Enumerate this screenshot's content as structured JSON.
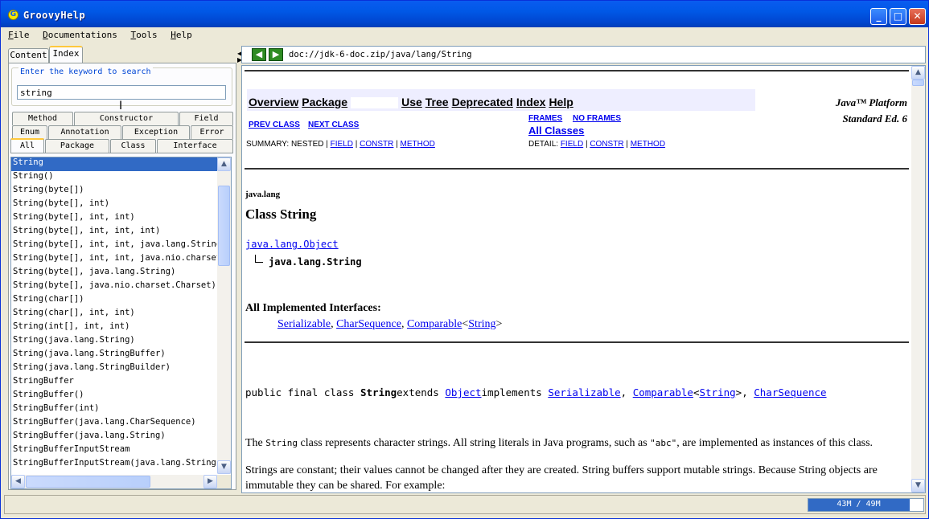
{
  "window": {
    "title": "GroovyHelp",
    "icon_glyph": "G",
    "minimize": "_",
    "maximize": "□",
    "close": "✕"
  },
  "menu": [
    "File",
    "Documentations",
    "Tools",
    "Help"
  ],
  "left": {
    "tabs": [
      "Content",
      "Index"
    ],
    "active_tab": "Index",
    "search_label": "Enter the keyword to search",
    "search_value": "string",
    "filter_tabs_row1": [
      "Method",
      "Constructor",
      "Field"
    ],
    "filter_tabs_row2": [
      "Enum",
      "Annotation",
      "Exception",
      "Error"
    ],
    "filter_tabs_row3": [
      "All",
      "Package",
      "Class",
      "Interface"
    ],
    "active_filter": "All",
    "results": [
      "String",
      "String()",
      "String(byte[])",
      "String(byte[], int)",
      "String(byte[], int, int)",
      "String(byte[], int, int, int)",
      "String(byte[], int, int, java.lang.String)",
      "String(byte[], int, int, java.nio.charset.Charset)",
      "String(byte[], java.lang.String)",
      "String(byte[], java.nio.charset.Charset)",
      "String(char[])",
      "String(char[], int, int)",
      "String(int[], int, int)",
      "String(java.lang.String)",
      "String(java.lang.StringBuffer)",
      "String(java.lang.StringBuilder)",
      "StringBuffer",
      "StringBuffer()",
      "StringBuffer(int)",
      "StringBuffer(java.lang.CharSequence)",
      "StringBuffer(java.lang.String)",
      "StringBufferInputStream",
      "StringBufferInputStream(java.lang.String)"
    ],
    "selected_index": 0
  },
  "right": {
    "back_icon": "back-arrow-icon",
    "forward_icon": "forward-arrow-icon",
    "address": "doc://jdk-6-doc.zip/java/lang/String",
    "doc": {
      "nav": [
        "Overview",
        "Package",
        "Use",
        "Tree",
        "Deprecated",
        "Index",
        "Help"
      ],
      "platform_line1": "Java™ Platform",
      "platform_line2": "Standard Ed. 6",
      "prev_class": "PREV CLASS",
      "next_class": "NEXT CLASS",
      "frames": "FRAMES",
      "no_frames": "NO FRAMES",
      "all_classes": "All Classes",
      "summary_prefix": "SUMMARY: NESTED | ",
      "detail_prefix": "DETAIL: ",
      "field": "FIELD",
      "constr": "CONSTR",
      "method": "METHOD",
      "sep": " | ",
      "package": "java.lang",
      "class_title": "Class String",
      "super_link": "java.lang.Object",
      "class_name": "java.lang.String",
      "impl_heading": "All Implemented Interfaces:",
      "impl_serializable": "Serializable",
      "impl_charseq": "CharSequence",
      "impl_comparable": "Comparable",
      "impl_string": "String",
      "comma": ", ",
      "lt": "<",
      "gt": ">",
      "decl_prefix": "public final class ",
      "decl_name": "String",
      "decl_extends": "extends ",
      "decl_object": "Object",
      "decl_implements": "implements ",
      "decl_serializable": "Serializable",
      "decl_comparable": "Comparable",
      "decl_string": "String",
      "decl_charseq": "CharSequence",
      "p1_a": "The ",
      "p1_code": "String",
      "p1_b": " class represents character strings. All string literals in Java programs, such as ",
      "p1_code2": "\"abc\"",
      "p1_c": ", are implemented as instances of this class.",
      "p2": "Strings are constant; their values cannot be changed after they are created. String buffers support mutable strings. Because String objects are immutable they can be shared. For example:"
    }
  },
  "status": {
    "memory": "43M / 49M",
    "memory_fraction": 0.878
  },
  "colors": {
    "selection": "#316AC5",
    "titlebar": "#0058E6",
    "link": "#0000EE",
    "nav_bg": "#EEEEFF"
  }
}
